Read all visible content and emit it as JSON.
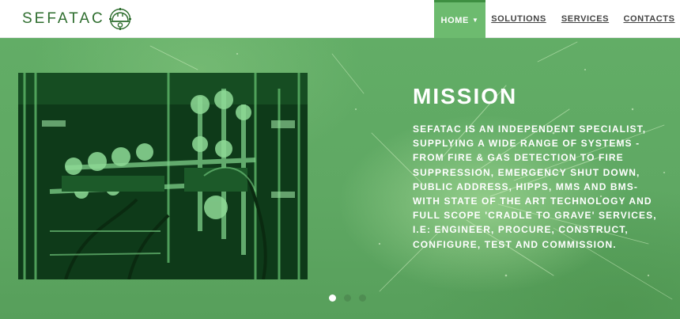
{
  "brand": {
    "name": "SEFATAC",
    "icon": "helmet-gear-logo-icon",
    "color": "#2f6e2f"
  },
  "nav": {
    "home": "HOME",
    "solutions": "SOLUTIONS",
    "services": "SERVICES",
    "contacts": "CONTACTS",
    "active_color": "#6dbb6f"
  },
  "slider": {
    "title": "MISSION",
    "body": "SEFATAC IS AN INDEPENDENT SPECIALIST, SUPPLYING A WIDE RANGE OF SYSTEMS - FROM FIRE & GAS DETECTION TO FIRE SUPPRESSION, EMERGENCY SHUT DOWN, PUBLIC ADDRESS, HIPPS, MMS AND BMS- WITH STATE OF THE ART TECHNOLOGY AND FULL SCOPE 'CRADLE TO GRAVE' SERVICES, I.E: ENGINEER, PROCURE, CONSTRUCT, CONFIGURE, TEST AND COMMISSION.",
    "photo": "industrial-valves-photo",
    "slide_count": 3,
    "active_slide": 1,
    "background_color": "#5fa863"
  }
}
